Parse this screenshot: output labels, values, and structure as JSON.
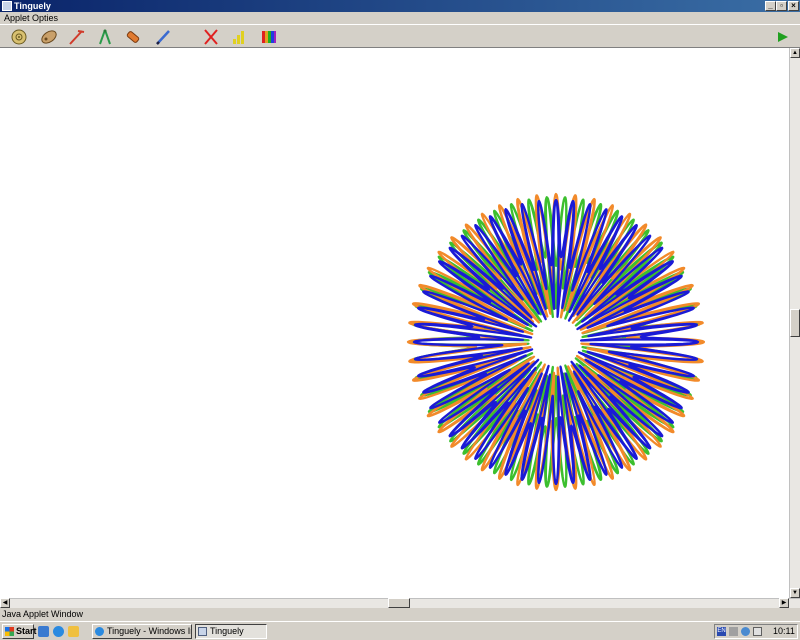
{
  "window": {
    "title": "Tinguely"
  },
  "menu": {
    "items": [
      "Applet",
      "Opties"
    ]
  },
  "toolbar": {
    "tools": [
      "motor-icon",
      "wheel-icon",
      "arm-icon",
      "compass-icon",
      "pen-holder-icon",
      "pen-icon",
      "clear-icon",
      "speed-icon",
      "colors-icon"
    ],
    "play": "play-icon"
  },
  "status": {
    "text": "Java Applet Window"
  },
  "taskbar": {
    "start": "Start",
    "tasks": [
      "Tinguely - Windows Inter...",
      "Tinguely"
    ],
    "language": "EN",
    "clock": "10:11"
  },
  "colors": {
    "blue": "#1a1ad6",
    "green": "#3cbf2e",
    "orange": "#f28a2a"
  }
}
